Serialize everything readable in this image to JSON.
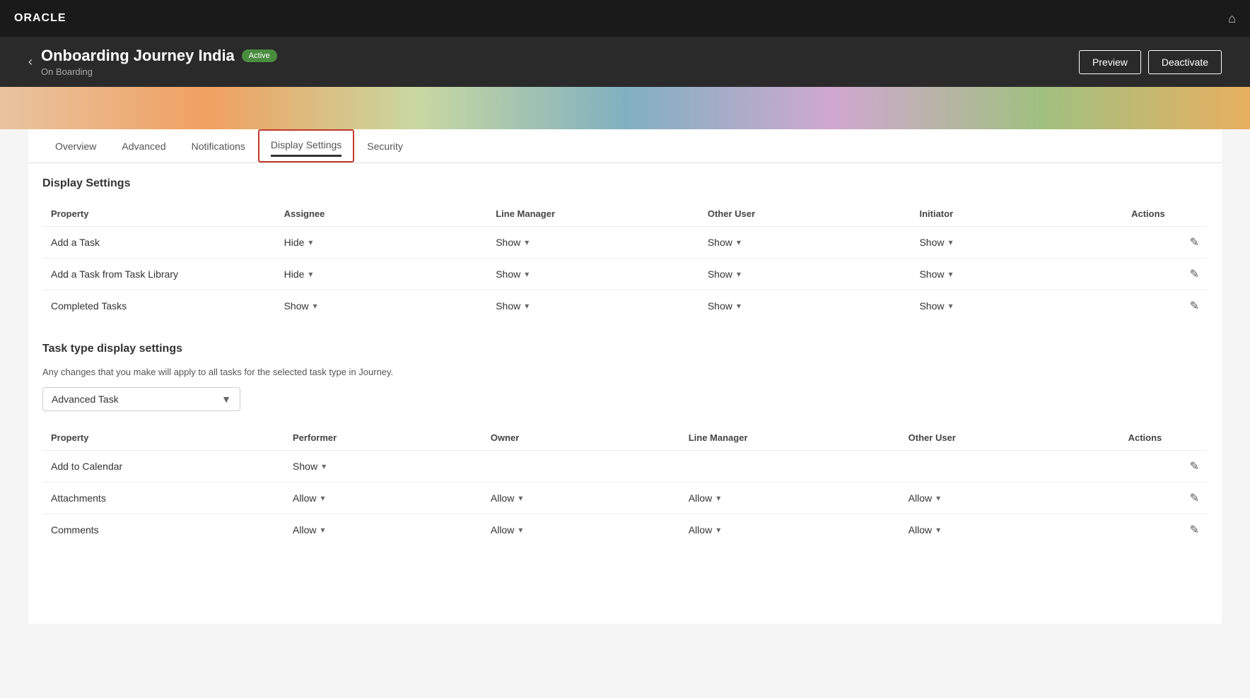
{
  "topbar": {
    "logo": "ORACLE",
    "home_icon": "⌂"
  },
  "header": {
    "back_label": "‹",
    "title": "Onboarding Journey India",
    "status": "Active",
    "subtitle": "On Boarding",
    "preview_label": "Preview",
    "deactivate_label": "Deactivate"
  },
  "tabs": [
    {
      "id": "overview",
      "label": "Overview"
    },
    {
      "id": "advanced",
      "label": "Advanced"
    },
    {
      "id": "notifications",
      "label": "Notifications"
    },
    {
      "id": "display-settings",
      "label": "Display Settings"
    },
    {
      "id": "security",
      "label": "Security"
    }
  ],
  "display_settings": {
    "section_title": "Display Settings",
    "columns": [
      "Property",
      "Assignee",
      "Line Manager",
      "Other User",
      "Initiator",
      "Actions"
    ],
    "rows": [
      {
        "property": "Add a Task",
        "assignee": "Hide",
        "line_manager": "Show",
        "other_user": "Show",
        "initiator": "Show"
      },
      {
        "property": "Add a Task from Task Library",
        "assignee": "Hide",
        "line_manager": "Show",
        "other_user": "Show",
        "initiator": "Show"
      },
      {
        "property": "Completed Tasks",
        "assignee": "Show",
        "line_manager": "Show",
        "other_user": "Show",
        "initiator": "Show"
      }
    ]
  },
  "task_type_section": {
    "title": "Task type display settings",
    "description": "Any changes that you make will apply to all tasks for the selected task type in Journey.",
    "dropdown_value": "Advanced Task",
    "dropdown_icon": "▼",
    "columns": [
      "Property",
      "Performer",
      "Owner",
      "Line Manager",
      "Other User",
      "Actions"
    ],
    "rows": [
      {
        "property": "Add to Calendar",
        "performer": "Show",
        "owner": "",
        "line_manager": "",
        "other_user": ""
      },
      {
        "property": "Attachments",
        "performer": "Allow",
        "owner": "Allow",
        "line_manager": "Allow",
        "other_user": "Allow"
      },
      {
        "property": "Comments",
        "performer": "Allow",
        "owner": "Allow",
        "line_manager": "Allow",
        "other_user": "Allow"
      }
    ]
  },
  "icons": {
    "edit": "✎",
    "chevron_down": "▾",
    "back": "‹",
    "home": "⌂"
  }
}
